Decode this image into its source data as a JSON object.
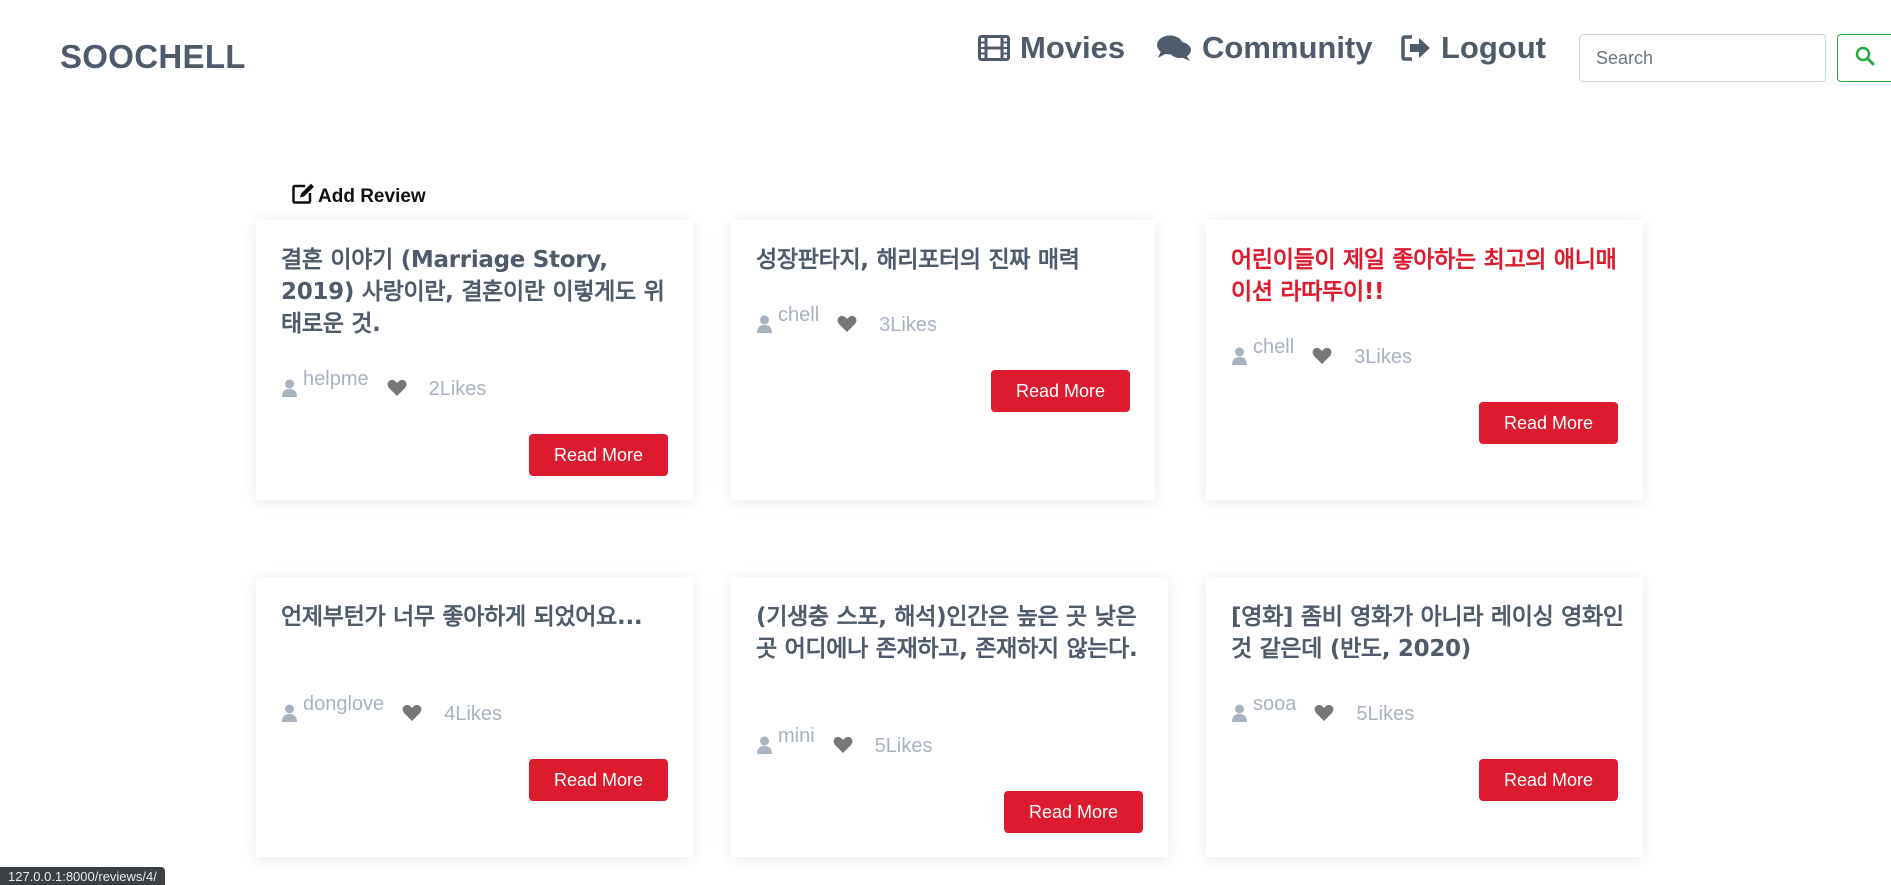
{
  "brand": "SOOCHELL",
  "nav": {
    "movies": "Movies",
    "community": "Community",
    "logout": "Logout"
  },
  "search": {
    "placeholder": "Search",
    "value": ""
  },
  "add_review": "Add Review",
  "cards": [
    {
      "title": "결혼 이야기 (Marriage Story, 2019) 사랑이란, 결혼이란 이렇게도 위태로운 것.",
      "author": "helpme",
      "likes": "2Likes",
      "button": "Read More"
    },
    {
      "title": "성장판타지, 해리포터의 진짜 매력",
      "author": "chell",
      "likes": "3Likes",
      "button": "Read More"
    },
    {
      "title": "어린이들이 제일 좋아하는 최고의 애니매이션 라따뚜이!!",
      "author": "chell",
      "likes": "3Likes",
      "button": "Read More"
    },
    {
      "title": "언제부턴가 너무 좋아하게 되었어요...",
      "author": "donglove",
      "likes": "4Likes",
      "button": "Read More"
    },
    {
      "title": "(기생충 스포, 해석)인간은 높은 곳 낮은 곳 어디에나 존재하고, 존재하지 않는다.",
      "author": "mini",
      "likes": "5Likes",
      "button": "Read More"
    },
    {
      "title": "[영화] 좀비 영화가 아니라 레이싱 영화인 것 같은데 (반도, 2020)",
      "author": "sooa",
      "likes": "5Likes",
      "button": "Read More"
    }
  ],
  "status_url": "127.0.0.1:8000/reviews/4/",
  "colors": {
    "accent": "#dc1c2e",
    "text": "#4f5b6b",
    "muted": "#a9b3bf",
    "search_btn": "#28a745"
  }
}
